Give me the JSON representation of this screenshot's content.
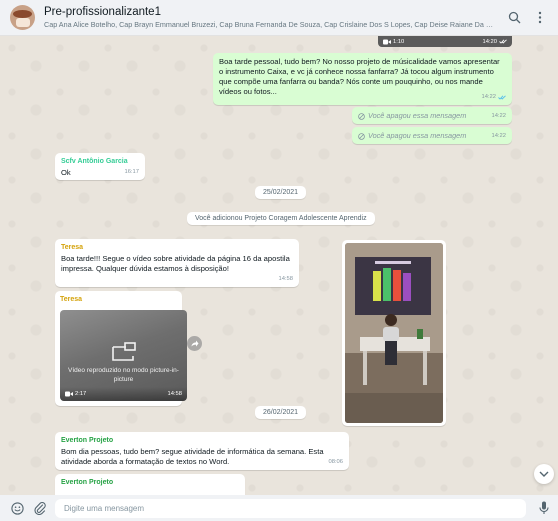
{
  "header": {
    "group_name": "Pre-profissionalizante1",
    "participants": "Cap Ana Alice Botelho, Cap Brayn Emmanuel Bruzezi, Cap Bruna Fernanda De Souza, Cap Crislaine Dos S Lopes, Cap Deise Raiane Da S..."
  },
  "top_video": {
    "duration": "1:10",
    "time": "14:20"
  },
  "messages": {
    "out_text": "Boa tarde pessoal, tudo bem? No nosso projeto de músicalidade vamos apresentar o instrumento Caixa, e vc já conhece nossa fanfarra? Já tocou algum instrumento que compõe uma fanfarra ou banda? Nós conte um pouquinho, ou nos mande vídeos ou fotos...",
    "out_time": "14:22",
    "deleted_1": "Você apagou essa mensagem",
    "deleted_1_time": "14:22",
    "deleted_2": "Você apagou essa mensagem",
    "deleted_2_time": "14:22",
    "sender_1": "Scfv Antônio Garcia",
    "msg_1": "Ok",
    "msg_1_time": "16:17",
    "date_1": "25/02/2021",
    "system_1": "Você adicionou Projeto Coragem Adolescente Aprendiz",
    "sender_2": "Teresa",
    "msg_2": "Boa tarde!!! Segue o vídeo sobre atividade da página 16 da apostila impressa. Qualquer dúvida estamos à disposição!",
    "msg_2_time": "14:58",
    "sender_3": "Teresa",
    "pip_label": "Vídeo reproduzido no modo picture-in-picture",
    "video_duration": "2:17",
    "video_time": "14:58",
    "date_2": "26/02/2021",
    "sender_4": "Everton Projeto",
    "msg_4": "Bom dia pessoas, tudo bem? segue atividade de informática da semana. Esta atividade aborda a formatação de textos no Word.",
    "msg_4_time": "08:06",
    "sender_5": "Everton Projeto"
  },
  "composer": {
    "placeholder": "Digite uma mensagem"
  },
  "colors": {
    "chat_bg": "#efeae2",
    "outgoing_bubble": "#d9fdd3",
    "sender_antonio": "#35cd96",
    "sender_teresa": "#d4a20a",
    "sender_everton": "#25a244"
  }
}
